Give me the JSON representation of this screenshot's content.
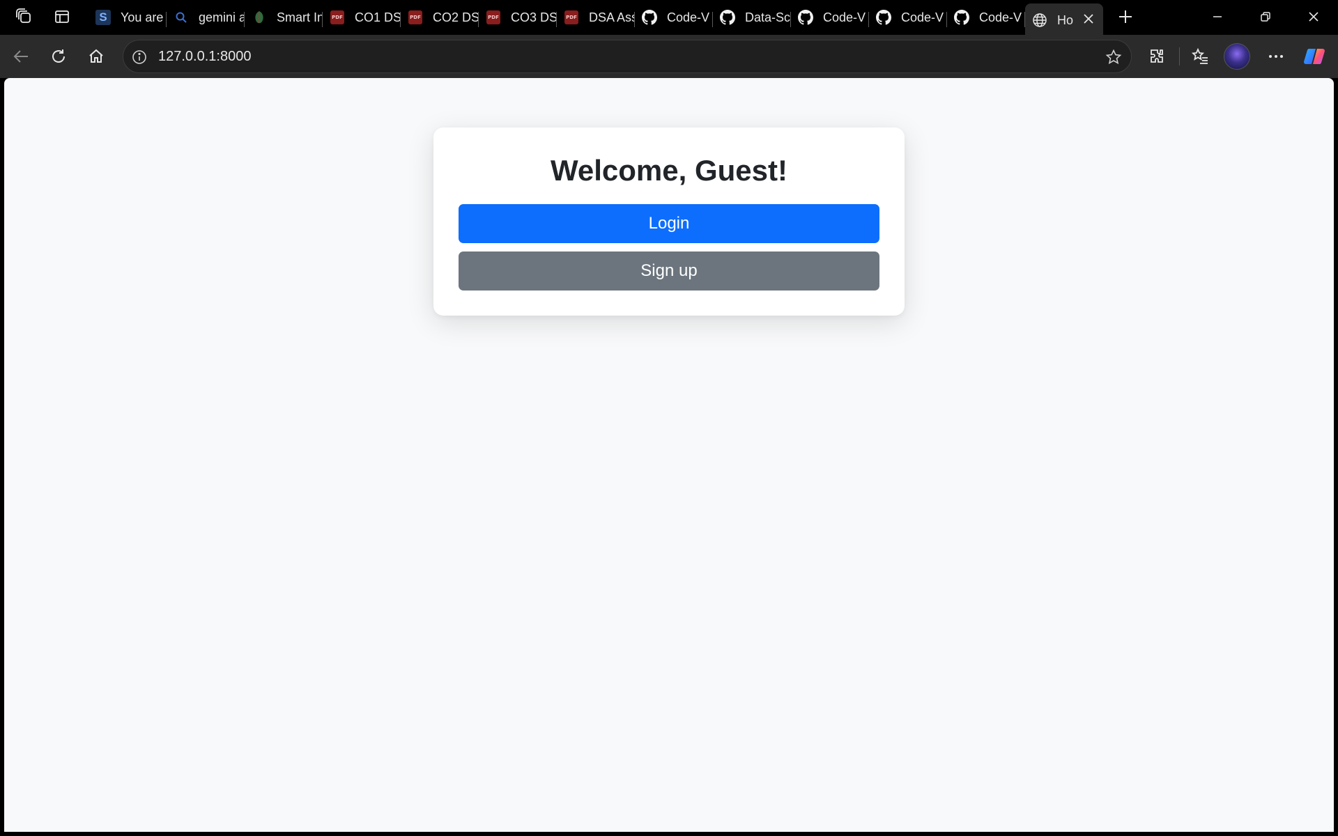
{
  "browser": {
    "tabs": [
      {
        "icon": "s-app-icon",
        "label": "You are"
      },
      {
        "icon": "search-icon",
        "label": "gemini a"
      },
      {
        "icon": "leaf-icon",
        "label": "Smart In"
      },
      {
        "icon": "pdf-icon",
        "label": "CO1 DS"
      },
      {
        "icon": "pdf-icon",
        "label": "CO2 DS"
      },
      {
        "icon": "pdf-icon",
        "label": "CO3 DS"
      },
      {
        "icon": "pdf-icon",
        "label": "DSA Ass"
      },
      {
        "icon": "github-icon",
        "label": "Code-V"
      },
      {
        "icon": "github-icon",
        "label": "Data-Sc"
      },
      {
        "icon": "github-icon",
        "label": "Code-V"
      },
      {
        "icon": "github-icon",
        "label": "Code-V"
      },
      {
        "icon": "github-icon",
        "label": "Code-V"
      }
    ],
    "active_tab": {
      "icon": "globe-icon",
      "label": "Ho"
    },
    "pdf_icon_text": "PDF",
    "s_icon_text": "S",
    "address": "127.0.0.1:8000"
  },
  "page": {
    "title": "Welcome, Guest!",
    "login_label": "Login",
    "signup_label": "Sign up"
  },
  "colors": {
    "primary": "#0d6efd",
    "secondary": "#6c757d",
    "page_bg": "#f8f9fa"
  }
}
